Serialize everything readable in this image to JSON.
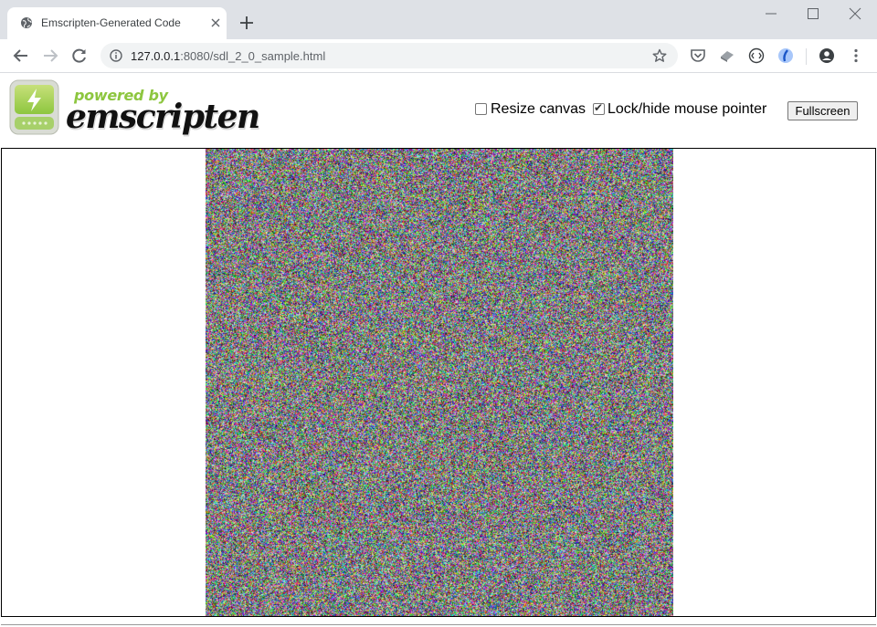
{
  "browser": {
    "tab": {
      "title": "Emscripten-Generated Code"
    },
    "address": {
      "host": "127.0.0.1",
      "rest": ":8080/sdl_2_0_sample.html"
    }
  },
  "page": {
    "logo": {
      "powered_by": "powered by",
      "wordmark": "emscripten"
    },
    "controls": {
      "resize_canvas": {
        "label": "Resize canvas",
        "checked": false
      },
      "lock_pointer": {
        "label": "Lock/hide mouse pointer",
        "checked": true
      },
      "fullscreen_label": "Fullscreen"
    }
  },
  "colors": {
    "logo_green": "#8dc63f",
    "chrome_bg": "#dee1e6",
    "omnibox_bg": "#f1f3f4"
  },
  "icons": [
    "globe-icon",
    "close-icon",
    "plus-icon",
    "minimize-icon",
    "maximize-icon",
    "back-icon",
    "forward-icon",
    "reload-icon",
    "info-icon",
    "star-icon",
    "pocket-icon",
    "extension-icon",
    "code-icon",
    "extension2-icon",
    "profile-icon",
    "menu-icon"
  ]
}
